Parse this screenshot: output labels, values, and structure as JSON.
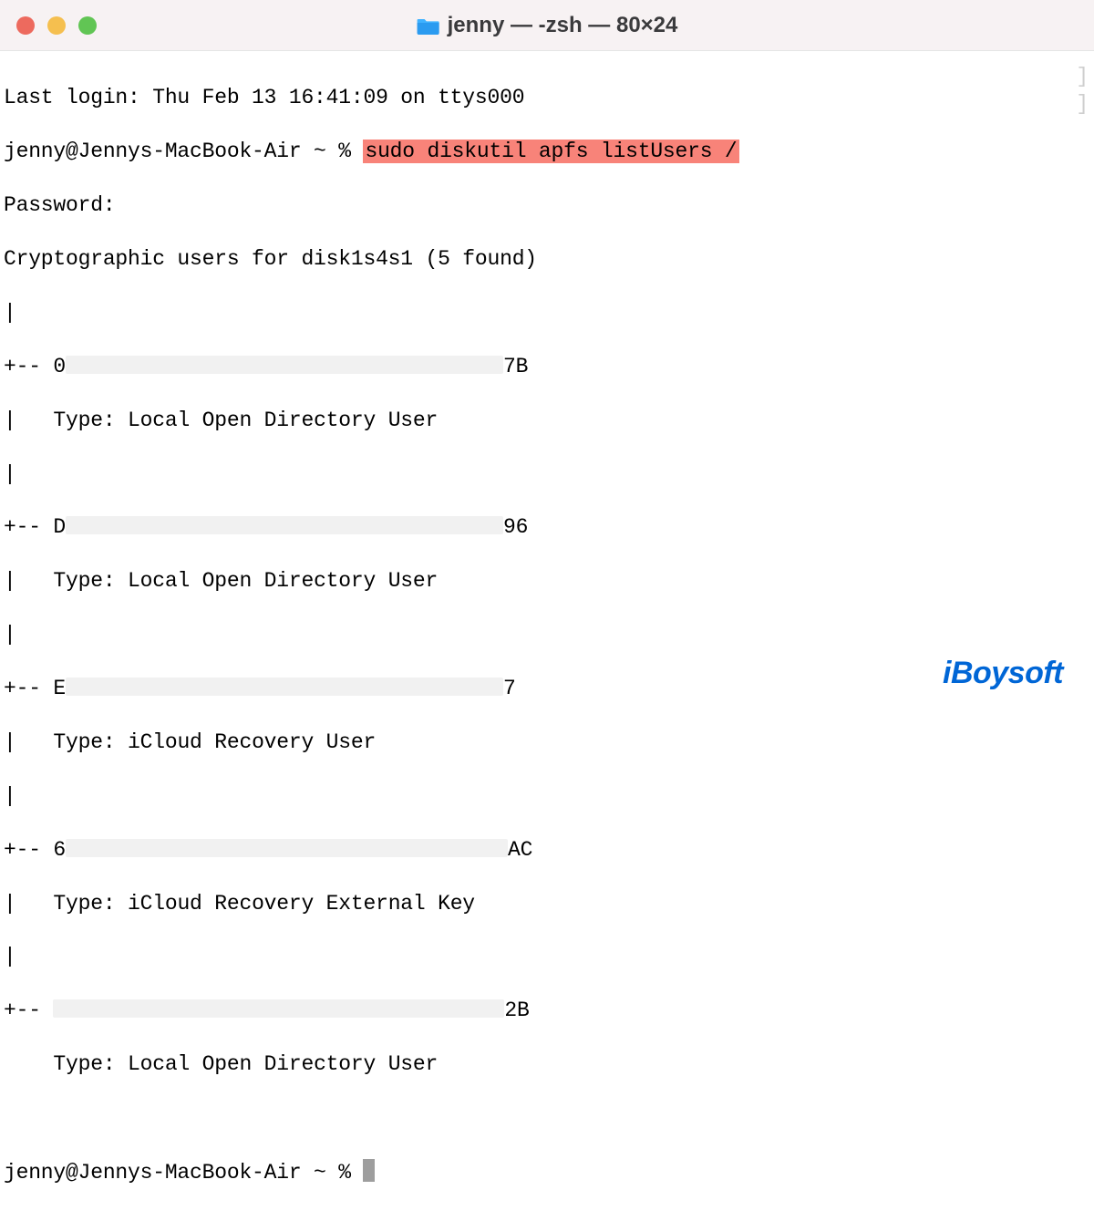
{
  "window": {
    "title": "jenny — -zsh — 80×24"
  },
  "terminal": {
    "last_login": "Last login: Thu Feb 13 16:41:09 on ttys000",
    "prompt1_left": "jenny@Jennys-MacBook-Air ~ % ",
    "command_hl": "sudo diskutil apfs listUsers /",
    "password_line": "Password:",
    "header_line": "Cryptographic users for disk1s4s1 (5 found)",
    "tree_pipe": "|",
    "tree_branch": "+-- ",
    "tree_last_cont": "|   ",
    "tree_last_end": "    ",
    "type_label": "Type: ",
    "users": [
      {
        "prefix": "0",
        "suffix": "7B",
        "type": "Local Open Directory User"
      },
      {
        "prefix": "D",
        "suffix": "96",
        "type": "Local Open Directory User"
      },
      {
        "prefix": "E",
        "suffix": "7",
        "type": "iCloud Recovery User"
      },
      {
        "prefix": "6",
        "suffix": "AC",
        "type": "iCloud Recovery External Key"
      },
      {
        "prefix": "",
        "suffix": "2B",
        "type": "Local Open Directory User"
      }
    ],
    "prompt2": "jenny@Jennys-MacBook-Air ~ % "
  },
  "watermark": "iBoysoft"
}
